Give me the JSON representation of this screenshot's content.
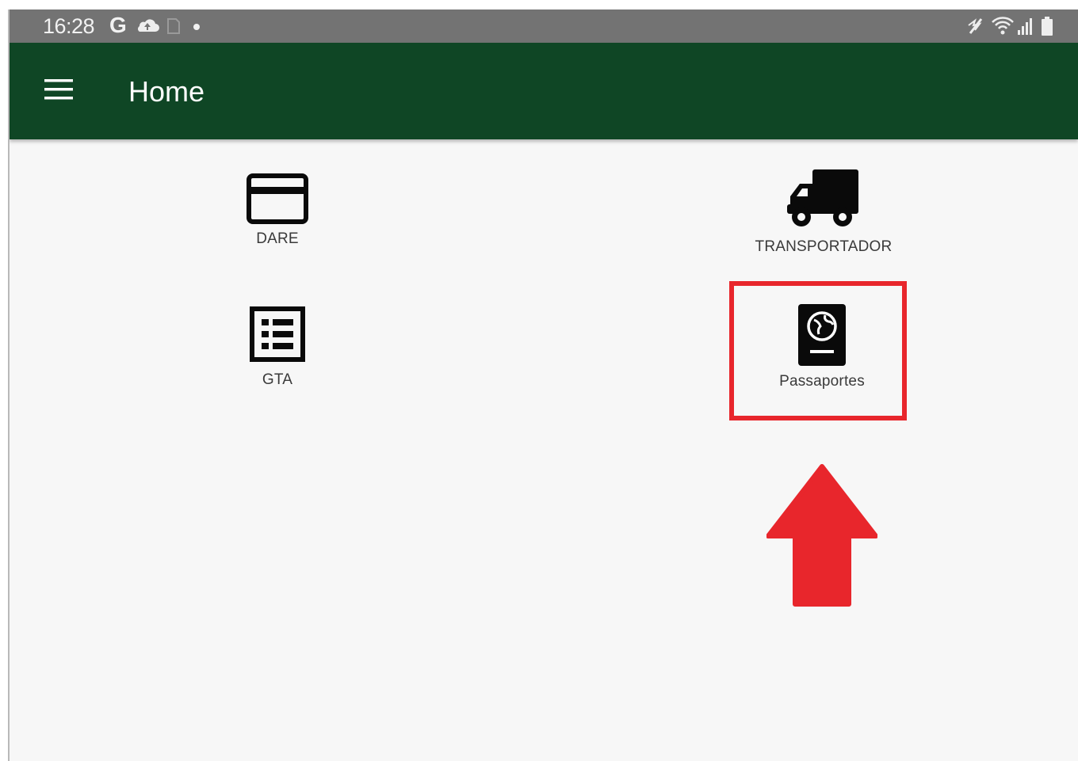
{
  "status_bar": {
    "time": "16:28",
    "google_indicator": "G",
    "left_icons": [
      "cloud-upload-icon",
      "sim-icon",
      "dot-icon"
    ],
    "right_icons": [
      "no-signal-icon",
      "wifi-icon",
      "signal-icon",
      "battery-icon"
    ]
  },
  "app_bar": {
    "title": "Home",
    "menu_icon": "menu-icon",
    "background_color": "#0f4625"
  },
  "tiles": [
    {
      "label": "DARE",
      "icon": "credit-card-icon"
    },
    {
      "label": "TRANSPORTADOR",
      "icon": "truck-icon"
    },
    {
      "label": "GTA",
      "icon": "list-document-icon"
    },
    {
      "label": "Passaportes",
      "icon": "passport-icon"
    }
  ],
  "annotation": {
    "highlight_color": "#e8262c",
    "highlighted_tile": "Passaportes",
    "arrow_icon": "arrow-up-icon"
  }
}
